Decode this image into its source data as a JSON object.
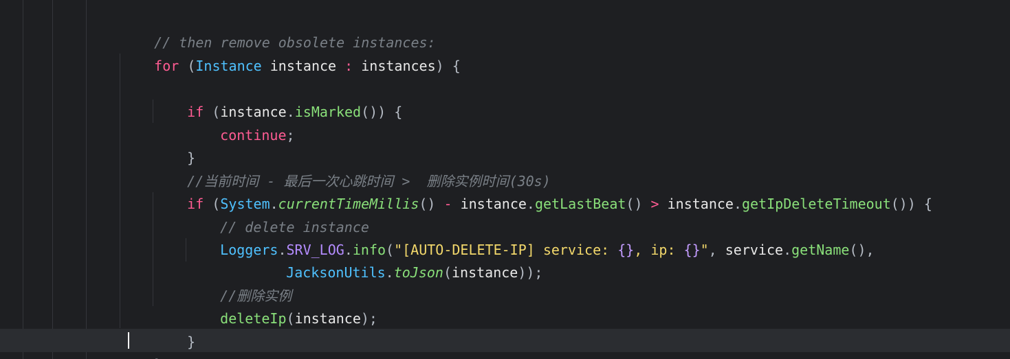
{
  "editor": {
    "language": "Java",
    "theme_colors": {
      "background": "#1e1f22",
      "current_line": "#2b2d31",
      "keyword": "#ff5c93",
      "type": "#4fc1ff",
      "method": "#8ae07a",
      "string": "#f3d86b",
      "comment": "#7a8087",
      "constant": "#b48cff"
    },
    "lines": {
      "l1": {
        "c1": "// then remove obsolete instances:"
      },
      "l2": {
        "kw_for": "for",
        "p1": " (",
        "type_instance": "Instance",
        "sp1": " ",
        "var_instance": "instance",
        "sp2": " ",
        "colon": ":",
        "sp3": " ",
        "var_instances": "instances",
        "p2": ") {"
      },
      "l3": {},
      "l4": {
        "kw_if": "if",
        "p1": " (",
        "obj": "instance",
        "dot": ".",
        "meth": "isMarked",
        "p2": "()) {"
      },
      "l5": {
        "kw_continue": "continue",
        "semi": ";"
      },
      "l6": {
        "brace": "}"
      },
      "l7": {
        "c1": "//当前时间 - 最后一次心跳时间 >  删除实例时间(30s)"
      },
      "l8": {
        "kw_if": "if",
        "p1": " (",
        "type_system": "System",
        "dot1": ".",
        "m_current": "currentTimeMillis",
        "p2": "() ",
        "minus": "-",
        "sp1": " ",
        "obj1": "instance",
        "dot2": ".",
        "m_lastbeat": "getLastBeat",
        "p3": "() ",
        "gt": ">",
        "sp2": " ",
        "obj2": "instance",
        "dot3": ".",
        "m_timeout": "getIpDeleteTimeout",
        "p4": "()) {"
      },
      "l9": {
        "c1": "// delete instance"
      },
      "l10": {
        "type_loggers": "Loggers",
        "dot1": ".",
        "const_srv": "SRV_LOG",
        "dot2": ".",
        "m_info": "info",
        "p1": "(",
        "s1": "\"[AUTO-DELETE-IP] service: ",
        "ph1": "{}",
        "s2": ", ip: ",
        "ph2": "{}",
        "s3": "\"",
        "p2": ", ",
        "obj": "service",
        "dot3": ".",
        "m_getname": "getName",
        "p3": "(),"
      },
      "l11": {
        "type_jackson": "JacksonUtils",
        "dot": ".",
        "m_tojson": "toJson",
        "p1": "(",
        "obj": "instance",
        "p2": "));"
      },
      "l12": {
        "c1": "//删除实例"
      },
      "l13": {
        "m_deleteip": "deleteIp",
        "p1": "(",
        "obj": "instance",
        "p2": ");"
      },
      "l14": {
        "brace": "}"
      },
      "l15": {
        "brace": "}"
      }
    }
  }
}
